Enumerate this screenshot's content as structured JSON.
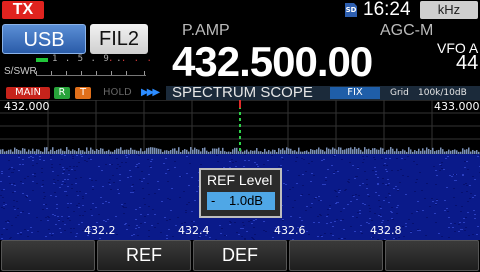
{
  "status": {
    "tx": "TX",
    "sd": "SD",
    "time": "16:24",
    "unit_button": "kHz"
  },
  "mode": {
    "mode_label": "USB",
    "filter_label": "FIL2"
  },
  "meter": {
    "scale": "1 . 5 . 9 .",
    "scale_plus": ". . . .",
    "swr_label": "S/SWR"
  },
  "frequency": {
    "preamp": "P.AMP",
    "agc": "AGC-M",
    "value": "432.500.00",
    "vfo": "VFO A",
    "vfo_number": "44"
  },
  "indicators": {
    "main": "MAIN",
    "r": "R",
    "t": "T",
    "hold": "HOLD",
    "play": "▶▶▶",
    "scope_title": "SPECTRUM SCOPE",
    "fix": "FIX",
    "grid": "Grid",
    "span": "100k/10dB"
  },
  "scope": {
    "range_start": "432.000",
    "range_end": "433.000",
    "axis_labels": [
      "432.2",
      "432.4",
      "432.6",
      "432.8"
    ],
    "marker_color": "#2fd24a",
    "waterfall_color": "#0a1a8a"
  },
  "ref_popup": {
    "title": "REF Level",
    "sign": "-",
    "value": "1.0dB"
  },
  "softkeys": [
    "",
    "REF",
    "DEF",
    "",
    ""
  ]
}
